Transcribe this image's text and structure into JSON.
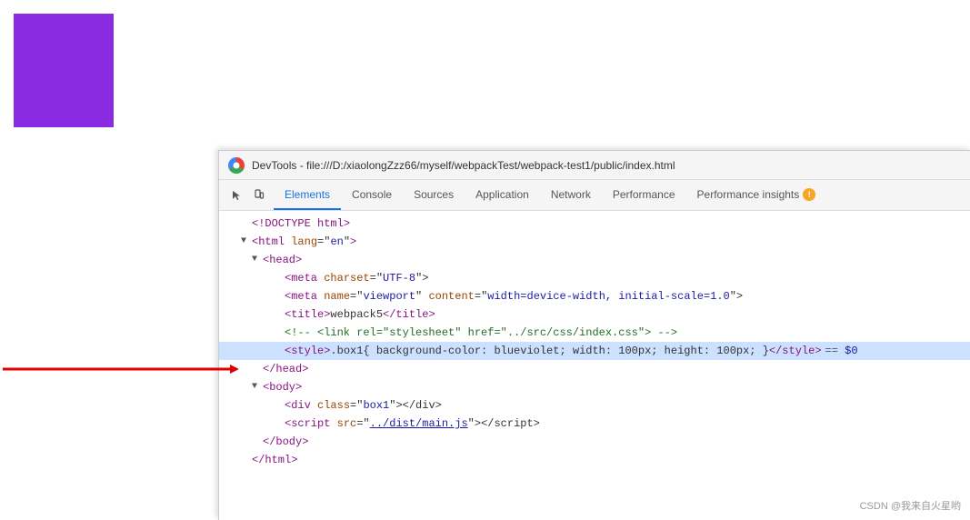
{
  "page": {
    "bg_color": "#ffffff",
    "purple_box_color": "blueviolet"
  },
  "devtools": {
    "title": "DevTools - file:///D:/xiaolongZzz66/myself/webpackTest/webpack-test1/public/index.html",
    "tabs": [
      {
        "id": "elements",
        "label": "Elements",
        "active": true
      },
      {
        "id": "console",
        "label": "Console",
        "active": false
      },
      {
        "id": "sources",
        "label": "Sources",
        "active": false
      },
      {
        "id": "application",
        "label": "Application",
        "active": false
      },
      {
        "id": "network",
        "label": "Network",
        "active": false
      },
      {
        "id": "performance",
        "label": "Performance",
        "active": false
      },
      {
        "id": "performance-insights",
        "label": "Performance insights",
        "active": false
      }
    ],
    "code_lines": [
      {
        "id": "doctype",
        "indent": 0,
        "has_arrow": false,
        "content": "<!DOCTYPE html>",
        "highlighted": false
      },
      {
        "id": "html-open",
        "indent": 0,
        "has_arrow": false,
        "content": "<html lang=\"en\">",
        "highlighted": false
      },
      {
        "id": "head-open",
        "indent": 1,
        "has_arrow": true,
        "arrow_dir": "down",
        "content": "<head>",
        "highlighted": false
      },
      {
        "id": "meta-charset",
        "indent": 2,
        "has_arrow": false,
        "content": "<meta charset=\"UTF-8\">",
        "highlighted": false
      },
      {
        "id": "meta-viewport",
        "indent": 2,
        "has_arrow": false,
        "content": "<meta name=\"viewport\" content=\"width=device-width, initial-scale=1.0\">",
        "highlighted": false
      },
      {
        "id": "title",
        "indent": 2,
        "has_arrow": false,
        "content": "<title>webpack5</title>",
        "highlighted": false
      },
      {
        "id": "comment-link",
        "indent": 2,
        "has_arrow": false,
        "content": "<!-- <link rel=\"stylesheet\" href=\"../src/css/index.css\"> -->",
        "highlighted": false
      },
      {
        "id": "style",
        "indent": 2,
        "has_arrow": false,
        "content": "<style>.box1{ background-color: blueviolet; width: 100px; height: 100px; }</style> == $0",
        "highlighted": true
      },
      {
        "id": "head-close",
        "indent": 1,
        "has_arrow": false,
        "content": "</head>",
        "highlighted": false
      },
      {
        "id": "body-open",
        "indent": 1,
        "has_arrow": true,
        "arrow_dir": "down",
        "content": "<body>",
        "highlighted": false
      },
      {
        "id": "div-box1",
        "indent": 2,
        "has_arrow": false,
        "content": "<div class=\"box1\"></div>",
        "highlighted": false
      },
      {
        "id": "script-main",
        "indent": 2,
        "has_arrow": false,
        "content": "<script src=\"../dist/main.js\"></script>",
        "highlighted": false
      },
      {
        "id": "body-close",
        "indent": 1,
        "has_arrow": false,
        "content": "</body>",
        "highlighted": false
      },
      {
        "id": "html-close",
        "indent": 0,
        "has_arrow": false,
        "content": "</html>",
        "highlighted": false
      }
    ]
  },
  "watermark": {
    "text": "CSDN @我来自火星哟"
  }
}
